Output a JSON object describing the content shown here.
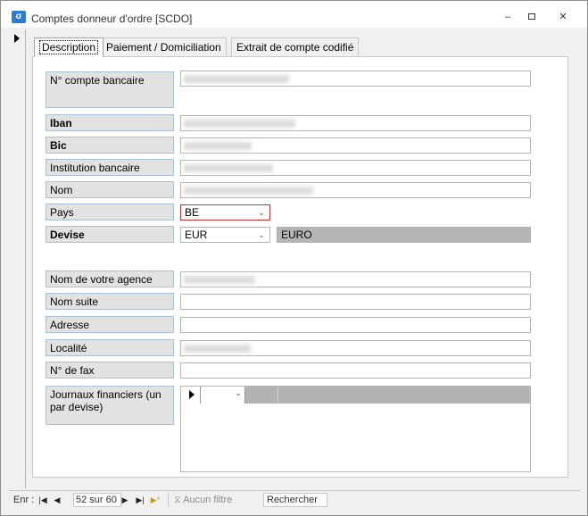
{
  "window": {
    "title": "Comptes donneur d'ordre [SCDO]",
    "controls": {
      "minimize": "–",
      "restore": "▫",
      "close": "✕"
    }
  },
  "tabs": [
    {
      "label": "Description",
      "active": true
    },
    {
      "label": "Paiement / Domiciliation",
      "active": false
    },
    {
      "label": "Extrait de compte codifié",
      "active": false
    }
  ],
  "fields": {
    "compte_bancaire": {
      "label": "N° compte bancaire",
      "value": ""
    },
    "iban": {
      "label": "Iban",
      "value": ""
    },
    "bic": {
      "label": "Bic",
      "value": ""
    },
    "institution": {
      "label": "Institution bancaire",
      "value": ""
    },
    "nom": {
      "label": "Nom",
      "value": ""
    },
    "pays": {
      "label": "Pays",
      "value": "BE"
    },
    "devise": {
      "label": "Devise",
      "value": "EUR",
      "description": "EURO"
    },
    "agence": {
      "label": "Nom de votre agence",
      "value": ""
    },
    "nom_suite": {
      "label": "Nom suite",
      "value": ""
    },
    "adresse": {
      "label": "Adresse",
      "value": ""
    },
    "localite": {
      "label": "Localité",
      "value": ""
    },
    "fax": {
      "label": "N° de fax",
      "value": ""
    },
    "journaux": {
      "label": "Journaux financiers (un par devise)"
    }
  },
  "navigation": {
    "record_label": "Enr :",
    "current": "52 sur 60",
    "filter": "Aucun filtre",
    "search": "Rechercher"
  },
  "colors": {
    "pays_border": "#d03030",
    "label_border": "#a9c1d6",
    "label_bg": "#e2e2e2"
  }
}
